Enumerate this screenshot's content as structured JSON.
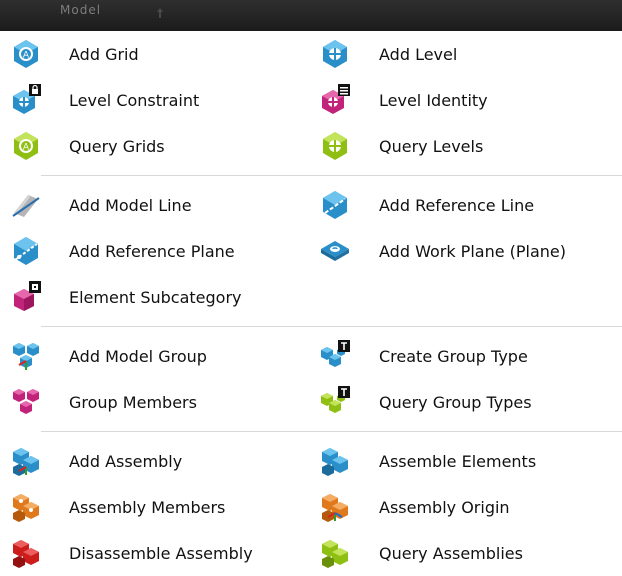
{
  "window": {
    "title": "Model"
  },
  "sections": [
    {
      "items": [
        {
          "label": "Add Grid",
          "icon": "grid-icon"
        },
        {
          "label": "Add Level",
          "icon": "level-icon"
        },
        {
          "label": "Level Constraint",
          "icon": "level-constraint-icon"
        },
        {
          "label": "Level Identity",
          "icon": "level-identity-icon"
        },
        {
          "label": "Query Grids",
          "icon": "query-grids-icon"
        },
        {
          "label": "Query Levels",
          "icon": "query-levels-icon"
        }
      ]
    },
    {
      "items": [
        {
          "label": "Add Model Line",
          "icon": "model-line-icon"
        },
        {
          "label": "Add Reference Line",
          "icon": "reference-line-icon"
        },
        {
          "label": "Add Reference Plane",
          "icon": "reference-plane-icon"
        },
        {
          "label": "Add Work Plane (Plane)",
          "icon": "work-plane-icon"
        },
        {
          "label": "Element Subcategory",
          "icon": "element-subcategory-icon"
        }
      ]
    },
    {
      "items": [
        {
          "label": "Add Model Group",
          "icon": "model-group-icon"
        },
        {
          "label": "Create Group Type",
          "icon": "create-group-type-icon"
        },
        {
          "label": "Group Members",
          "icon": "group-members-icon"
        },
        {
          "label": "Query Group Types",
          "icon": "query-group-types-icon"
        }
      ]
    },
    {
      "items": [
        {
          "label": "Add Assembly",
          "icon": "assembly-icon"
        },
        {
          "label": "Assemble Elements",
          "icon": "assemble-elements-icon"
        },
        {
          "label": "Assembly Members",
          "icon": "assembly-members-icon"
        },
        {
          "label": "Assembly Origin",
          "icon": "assembly-origin-icon"
        },
        {
          "label": "Disassemble Assembly",
          "icon": "disassemble-assembly-icon"
        },
        {
          "label": "Query Assemblies",
          "icon": "query-assemblies-icon"
        }
      ]
    }
  ],
  "colors": {
    "titlebar": "#1f1f1f",
    "title_text": "#7d7d7d",
    "blue": "#2a8fc9",
    "magenta": "#c2237a",
    "lime": "#8fbf12",
    "orange": "#e0781c",
    "red": "#cc1c1c",
    "separator": "#d8d8d8"
  }
}
